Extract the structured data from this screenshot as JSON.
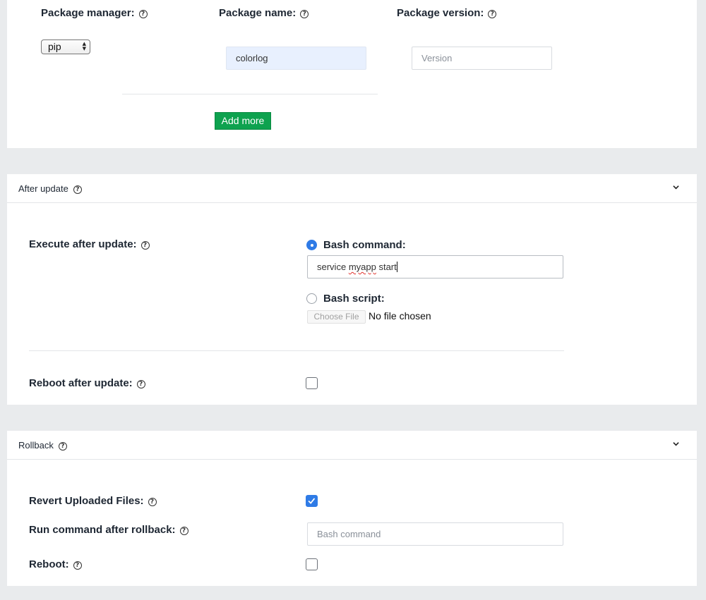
{
  "packages": {
    "manager_label": "Package manager:",
    "name_label": "Package name:",
    "version_label": "Package version:",
    "manager_value": "pip",
    "name_value": "colorlog",
    "version_placeholder": "Version",
    "add_more_label": "Add more"
  },
  "after_update": {
    "title": "After update",
    "execute_label": "Execute after update:",
    "bash_command_label": "Bash command:",
    "bash_command_value_word1": "service",
    "bash_command_value_word2": "myapp",
    "bash_command_value_word3": "start",
    "bash_script_label": "Bash script:",
    "choose_file_label": "Choose File",
    "no_file_label": "No file chosen",
    "reboot_label": "Reboot after update:",
    "bash_command_selected": true,
    "reboot_checked": false
  },
  "rollback": {
    "title": "Rollback",
    "revert_label": "Revert Uploaded Files:",
    "run_command_label": "Run command after rollback:",
    "bash_command_placeholder": "Bash command",
    "reboot_label": "Reboot:",
    "revert_checked": true,
    "reboot_checked": false
  },
  "icons": {
    "help": "help-circle-icon",
    "chevron": "chevron-down-icon",
    "checkmark": "checkmark-icon"
  },
  "colors": {
    "accent": "#2f7be6",
    "button_green": "#0ea24f",
    "page_background": "#e9ebed"
  }
}
